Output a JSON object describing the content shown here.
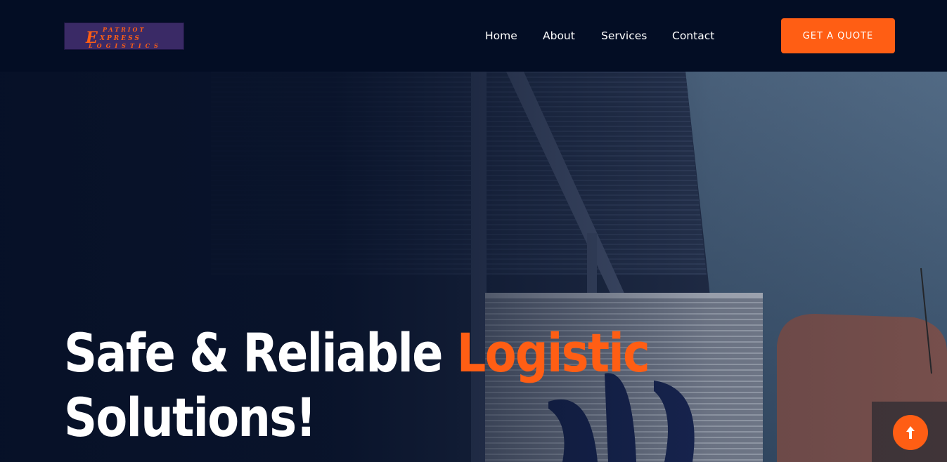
{
  "header": {
    "logo": {
      "line1": "PATRIOT",
      "line2": "XPRESS",
      "line3": "LOGISTICS",
      "monogram": "E"
    },
    "nav": [
      {
        "label": "Home"
      },
      {
        "label": "About"
      },
      {
        "label": "Services"
      },
      {
        "label": "Contact"
      }
    ],
    "cta_label": "GET A QUOTE"
  },
  "hero": {
    "title_part1": "Safe & Reliable ",
    "title_accent": "Logistic",
    "title_part2": "Solutions!"
  },
  "scroll_top_icon": "arrow-up-icon",
  "colors": {
    "accent": "#ff5e14",
    "header_bg": "#030d24",
    "hero_overlay": "#061027"
  }
}
